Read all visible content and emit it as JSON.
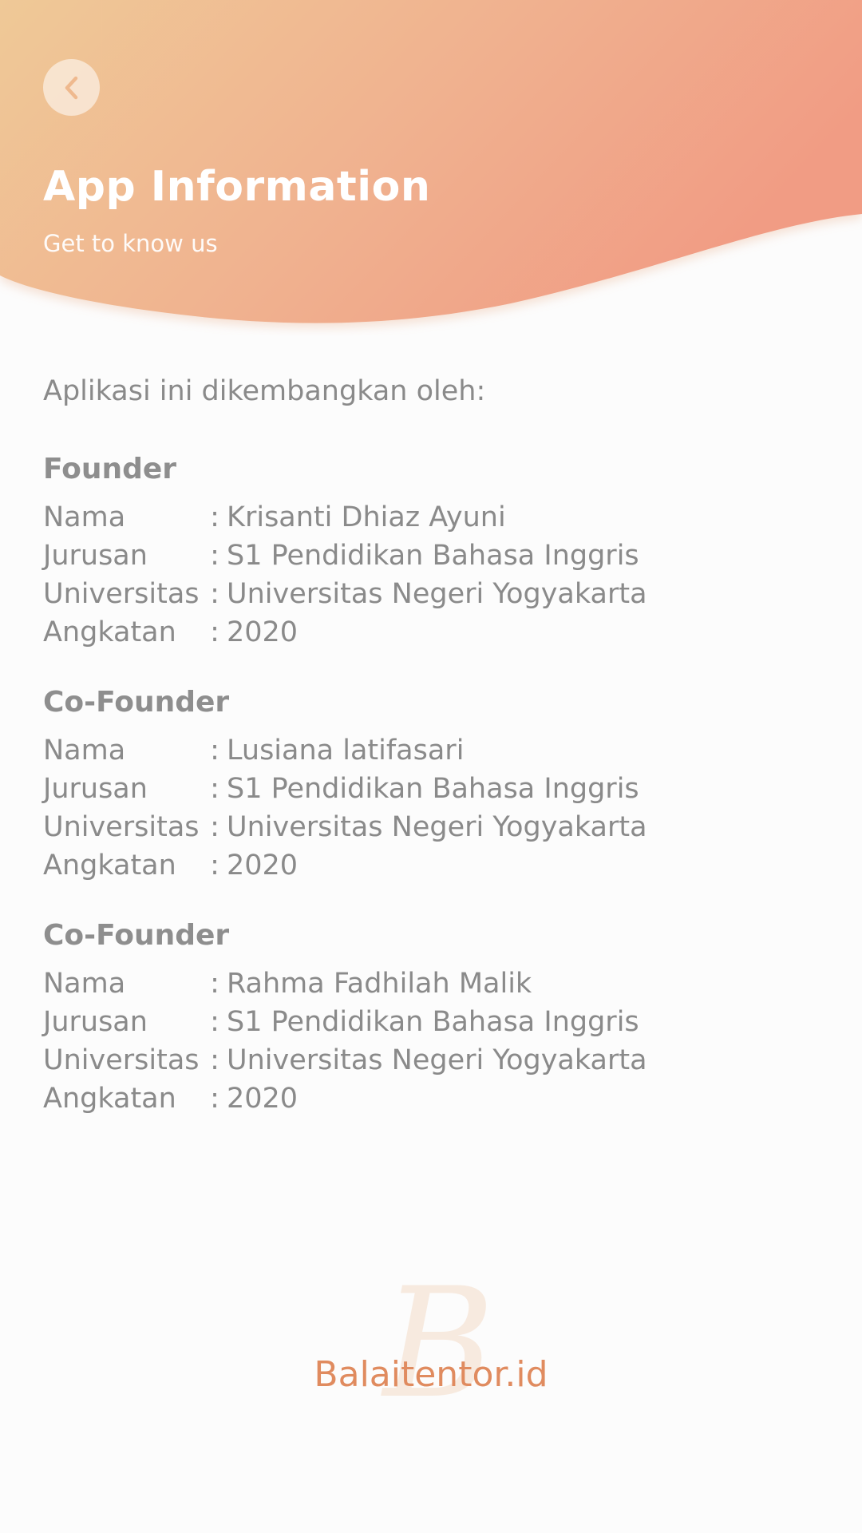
{
  "header": {
    "title": "App Information",
    "subtitle": "Get to know us",
    "back_icon": "chevron-left-icon",
    "gradient_start": "#efc997",
    "gradient_end": "#f19c84"
  },
  "content": {
    "intro": "Aplikasi ini dikembangkan oleh:",
    "sections": [
      {
        "title": "Founder",
        "rows": [
          {
            "label": "Nama",
            "value": "Krisanti Dhiaz Ayuni"
          },
          {
            "label": "Jurusan",
            "value": "S1 Pendidikan Bahasa Inggris"
          },
          {
            "label": "Universitas",
            "value": "Universitas Negeri Yogyakarta"
          },
          {
            "label": "Angkatan",
            "value": "2020"
          }
        ]
      },
      {
        "title": "Co-Founder",
        "rows": [
          {
            "label": "Nama",
            "value": "Lusiana latifasari"
          },
          {
            "label": "Jurusan",
            "value": "S1 Pendidikan Bahasa Inggris"
          },
          {
            "label": "Universitas",
            "value": "Universitas Negeri Yogyakarta"
          },
          {
            "label": "Angkatan",
            "value": "2020"
          }
        ]
      },
      {
        "title": "Co-Founder",
        "rows": [
          {
            "label": "Nama",
            "value": "Rahma Fadhilah Malik"
          },
          {
            "label": "Jurusan",
            "value": "S1 Pendidikan Bahasa Inggris"
          },
          {
            "label": "Universitas",
            "value": "Universitas Negeri Yogyakarta"
          },
          {
            "label": "Angkatan",
            "value": "2020"
          }
        ]
      }
    ],
    "separator": ":"
  },
  "brand": {
    "mark": "B",
    "name": "Balaitentor.id",
    "color": "#e08b5f"
  }
}
